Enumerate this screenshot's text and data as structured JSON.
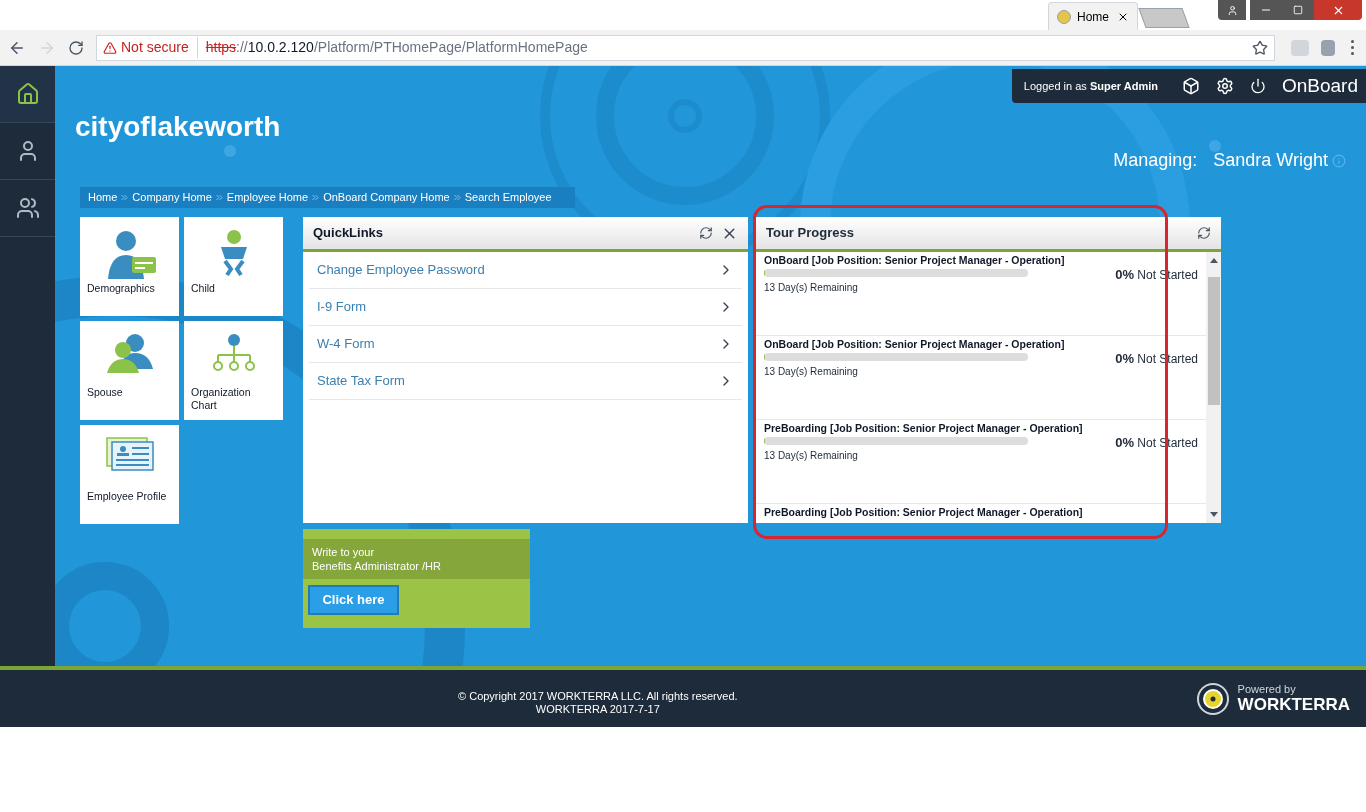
{
  "browser": {
    "tab": {
      "title": "Home",
      "selected": true
    },
    "address": {
      "security": "Not secure",
      "scheme": "https",
      "separator": "://",
      "host": "10.0.2.120",
      "path": "/Platform/PTHomePage/PlatformHomePage"
    }
  },
  "sidebar": {
    "items": [
      {
        "kind": "home",
        "selected": true
      },
      {
        "kind": "person",
        "selected": false
      },
      {
        "kind": "people",
        "selected": false
      }
    ]
  },
  "top_bar": {
    "logged_in": "Logged in as **Super Admin**",
    "app_name": "OnBoard"
  },
  "company": "cityoflakeworth",
  "managing": {
    "label": "Managing:",
    "name": "Sandra Wright"
  },
  "breadcrumbs": [
    "Home",
    "Company Home",
    "Employee Home",
    "OnBoard Company Home",
    "Search Employee"
  ],
  "tiles": [
    {
      "kind": "demographics",
      "label": "Demographics"
    },
    {
      "kind": "child",
      "label": "Child"
    },
    {
      "kind": "spouse",
      "label": "Spouse"
    },
    {
      "kind": "org",
      "label": "Organization Chart"
    },
    {
      "kind": "profile",
      "label": "Employee Profile"
    }
  ],
  "quicklinks": {
    "title": "QuickLinks",
    "items": [
      "Change Employee Password",
      "I-9 Form",
      "W-4 Form",
      "State Tax Form"
    ]
  },
  "benefits": {
    "lines": [
      "Write to your",
      "Benefits Administrator /HR"
    ],
    "button": "Click here"
  },
  "tour_progress": {
    "title": "Tour Progress",
    "items": [
      {
        "title": "OnBoard [Job Position: Senior Project Manager - Operation]",
        "level": 0,
        "percent": "0%",
        "status": "Not Started",
        "remaining": "13 Day(s) Remaining"
      },
      {
        "title": "OnBoard [Job Position: Senior Project Manager - Operation]",
        "level": 0,
        "percent": "0%",
        "status": "Not Started",
        "remaining": "13 Day(s) Remaining"
      },
      {
        "title": "PreBoarding [Job Position: Senior Project Manager - Operation]",
        "level": 0,
        "percent": "0%",
        "status": "Not Started",
        "remaining": "13 Day(s) Remaining"
      },
      {
        "title": "PreBoarding [Job Position: Senior Project Manager - Operation]"
      }
    ]
  },
  "footer": {
    "copyright": "© Copyright 2017 WORKTERRA LLC. All rights reserved.",
    "version": "WORKTERRA 2017-7-17",
    "powered_by": "Powered by",
    "brand": "WORKTERRA"
  }
}
